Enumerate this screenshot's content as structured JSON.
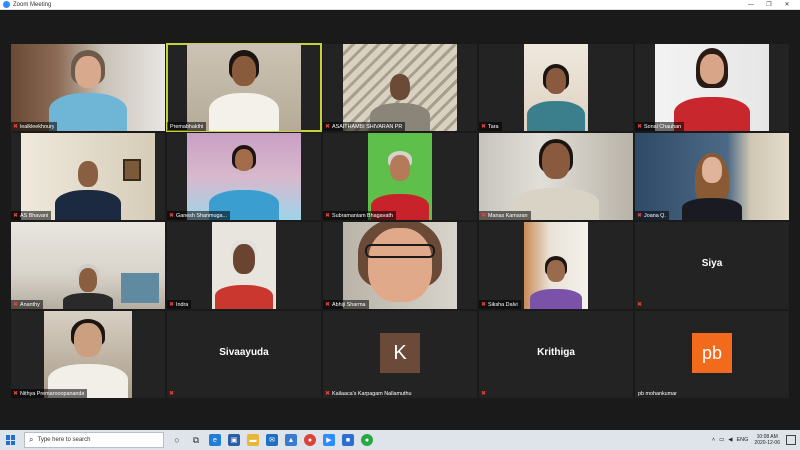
{
  "window": {
    "title": "Zoom Meeting",
    "controls": [
      "—",
      "❐",
      "✕"
    ]
  },
  "participants": [
    {
      "name": "lealkleekhoury",
      "mic": "muted",
      "video": true,
      "active": false
    },
    {
      "name": "Premabhakthi",
      "mic": "unmuted",
      "video": true,
      "active": true
    },
    {
      "name": "ASAITHAMBI SHIVARAN PR",
      "mic": "muted",
      "video": true,
      "active": false
    },
    {
      "name": "Tara",
      "mic": "muted",
      "video": true,
      "active": false
    },
    {
      "name": "Sonal Chauhan",
      "mic": "muted",
      "video": true,
      "active": false
    },
    {
      "name": "AS Bhavani",
      "mic": "muted",
      "video": true,
      "active": false
    },
    {
      "name": "Ganesh Shanmuga...",
      "mic": "muted",
      "video": true,
      "active": false
    },
    {
      "name": "Subramaniam Bhagavath",
      "mic": "muted",
      "video": true,
      "active": false
    },
    {
      "name": "Manas Kamaran",
      "mic": "muted",
      "video": true,
      "active": false
    },
    {
      "name": "Joana Q.",
      "mic": "muted",
      "video": true,
      "active": false
    },
    {
      "name": "Ananthy",
      "mic": "muted",
      "video": true,
      "active": false
    },
    {
      "name": "Indra",
      "mic": "muted",
      "video": true,
      "active": false
    },
    {
      "name": "Abhiji Sharma",
      "mic": "muted",
      "video": true,
      "active": false
    },
    {
      "name": "Siksha Dalvi",
      "mic": "muted",
      "video": true,
      "active": false
    },
    {
      "name": "",
      "display_name": "Siya",
      "mic": "muted",
      "video": false,
      "active": false
    },
    {
      "name": "Nithya Premarooopananda",
      "mic": "muted",
      "video": true,
      "active": false
    },
    {
      "name": "",
      "display_name": "Sivaayuda",
      "mic": "muted",
      "video": false,
      "active": false
    },
    {
      "name": "Kailaaca's Karpagam Nallamuthu",
      "avatar_letter": "K",
      "avatar_color": "#6b4a3a",
      "mic": "muted",
      "video": false,
      "active": false
    },
    {
      "name": "",
      "display_name": "Krithiga",
      "mic": "muted",
      "video": false,
      "active": false
    },
    {
      "name": "pb mohankumar",
      "avatar_letter": "pb",
      "avatar_color": "#f26b1d",
      "mic": "muted",
      "video": false,
      "active": false
    }
  ],
  "taskbar": {
    "search_placeholder": "Type here to search",
    "icons": [
      "task-view",
      "edge",
      "store",
      "file-explorer",
      "mail",
      "photos",
      "chrome",
      "zoom",
      "video",
      "chrome-alt"
    ],
    "tray": {
      "lang": "ENG",
      "time": "10:08 AM",
      "date": "2020-12-06"
    }
  },
  "colors": {
    "active_border": "#c5d33a",
    "mute_red": "#e0433a",
    "stage_bg": "#1a1a1a",
    "tile_bg": "#232323"
  }
}
